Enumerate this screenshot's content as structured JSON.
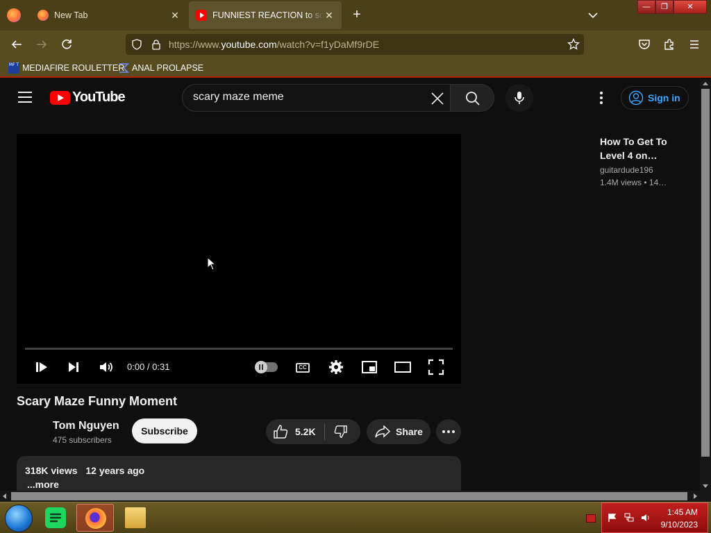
{
  "browser": {
    "tabs": [
      {
        "title": "New Tab",
        "active": false
      },
      {
        "title": "FUNNIEST REACTION to scary maze",
        "active": true
      }
    ],
    "url": {
      "prefix": "https://www.",
      "domain": "youtube.com",
      "path": "/watch?v=f1yDaMf9rDE"
    },
    "bookmarks": [
      {
        "label": "MEDIAFIRE ROULETTER",
        "icon": "mft-icon"
      },
      {
        "label": "ANAL PROLAPSE",
        "icon": "sigma-icon"
      }
    ],
    "bookmark_icon_text": "MF T"
  },
  "youtube": {
    "logo_text": "YouTube",
    "search_value": "scary maze meme",
    "sign_in_label": "Sign in",
    "player": {
      "time": "0:00 / 0:31",
      "cc_label": "CC"
    },
    "video": {
      "title": "Scary Maze Funny Moment",
      "channel": "Tom Nguyen",
      "subscribers": "475 subscribers",
      "subscribe_label": "Subscribe",
      "likes": "5.2K",
      "share_label": "Share",
      "views": "318K views",
      "age": "12 years ago",
      "more_label": "...more"
    },
    "related": [
      {
        "title": "How To Get To Level 4 on…",
        "channel": "guitardude196",
        "views": "1.4M views",
        "age": "• 14…"
      }
    ]
  },
  "taskbar": {
    "time": "1:45 AM",
    "date": "9/10/2023"
  },
  "colors": {
    "browser_chrome": "#574b1f",
    "tab_strip": "#4a3f16",
    "youtube_red": "#ff0000",
    "signin_blue": "#3ea6ff",
    "page_bg": "#0f0f0f",
    "tray_red": "#c11f1f"
  }
}
